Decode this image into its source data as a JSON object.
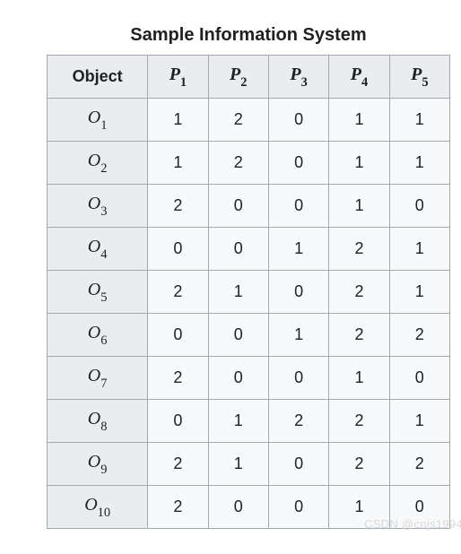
{
  "title": "Sample Information System",
  "headers": {
    "object": "Object",
    "p_letter": "P",
    "p_subs": [
      "1",
      "2",
      "3",
      "4",
      "5"
    ]
  },
  "row_letter": "O",
  "rows": [
    {
      "sub": "1",
      "values": [
        "1",
        "2",
        "0",
        "1",
        "1"
      ]
    },
    {
      "sub": "2",
      "values": [
        "1",
        "2",
        "0",
        "1",
        "1"
      ]
    },
    {
      "sub": "3",
      "values": [
        "2",
        "0",
        "0",
        "1",
        "0"
      ]
    },
    {
      "sub": "4",
      "values": [
        "0",
        "0",
        "1",
        "2",
        "1"
      ]
    },
    {
      "sub": "5",
      "values": [
        "2",
        "1",
        "0",
        "2",
        "1"
      ]
    },
    {
      "sub": "6",
      "values": [
        "0",
        "0",
        "1",
        "2",
        "2"
      ]
    },
    {
      "sub": "7",
      "values": [
        "2",
        "0",
        "0",
        "1",
        "0"
      ]
    },
    {
      "sub": "8",
      "values": [
        "0",
        "1",
        "2",
        "2",
        "1"
      ]
    },
    {
      "sub": "9",
      "values": [
        "2",
        "1",
        "0",
        "2",
        "2"
      ]
    },
    {
      "sub": "10",
      "values": [
        "2",
        "0",
        "0",
        "1",
        "0"
      ]
    }
  ],
  "watermark": "CSDN @cnjs1994",
  "chart_data": {
    "type": "table",
    "title": "Sample Information System",
    "columns": [
      "Object",
      "P1",
      "P2",
      "P3",
      "P4",
      "P5"
    ],
    "rows": [
      [
        "O1",
        1,
        2,
        0,
        1,
        1
      ],
      [
        "O2",
        1,
        2,
        0,
        1,
        1
      ],
      [
        "O3",
        2,
        0,
        0,
        1,
        0
      ],
      [
        "O4",
        0,
        0,
        1,
        2,
        1
      ],
      [
        "O5",
        2,
        1,
        0,
        2,
        1
      ],
      [
        "O6",
        0,
        0,
        1,
        2,
        2
      ],
      [
        "O7",
        2,
        0,
        0,
        1,
        0
      ],
      [
        "O8",
        0,
        1,
        2,
        2,
        1
      ],
      [
        "O9",
        2,
        1,
        0,
        2,
        2
      ],
      [
        "O10",
        2,
        0,
        0,
        1,
        0
      ]
    ]
  }
}
